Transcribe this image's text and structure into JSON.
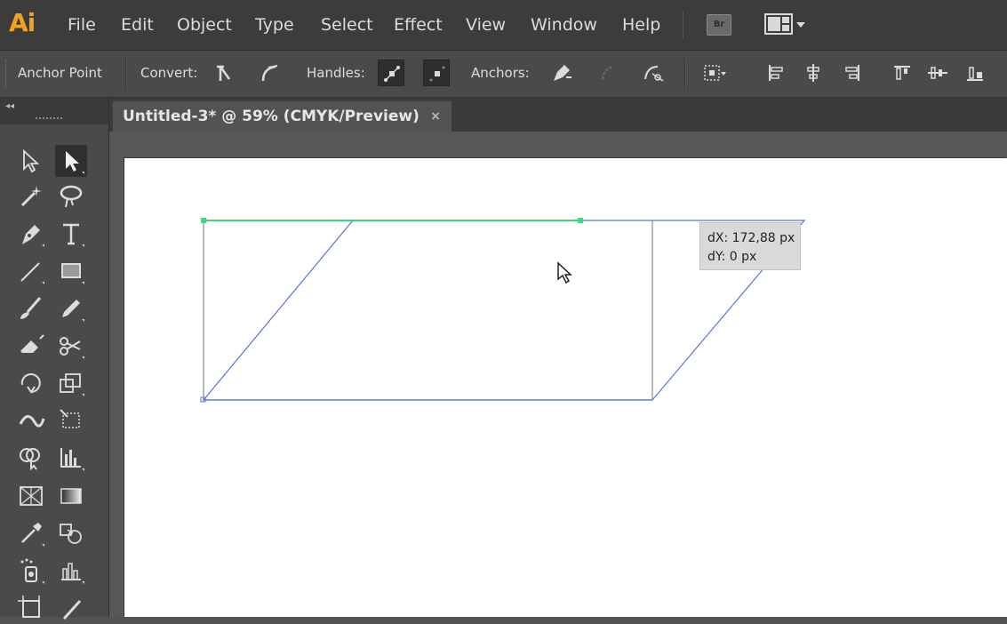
{
  "app": {
    "logo": "Ai"
  },
  "menu": {
    "items": [
      "File",
      "Edit",
      "Object",
      "Type",
      "Select",
      "Effect",
      "View",
      "Window",
      "Help"
    ],
    "bridge_label": "Br",
    "workspace_icon": "workspace-layout-icon"
  },
  "control": {
    "tool_name": "Anchor Point",
    "convert_label": "Convert:",
    "handles_label": "Handles:",
    "anchors_label": "Anchors:"
  },
  "document": {
    "tab_title": "Untitled-3* @ 59% (CMYK/Preview)",
    "tab_close": "×"
  },
  "tooltip": {
    "dx": "dX: 172,88 px",
    "dy": "dY: 0 px"
  },
  "colors": {
    "accent": "#f0a31c",
    "path_blue": "#5a72e0",
    "selection_green": "#3ed67a"
  }
}
